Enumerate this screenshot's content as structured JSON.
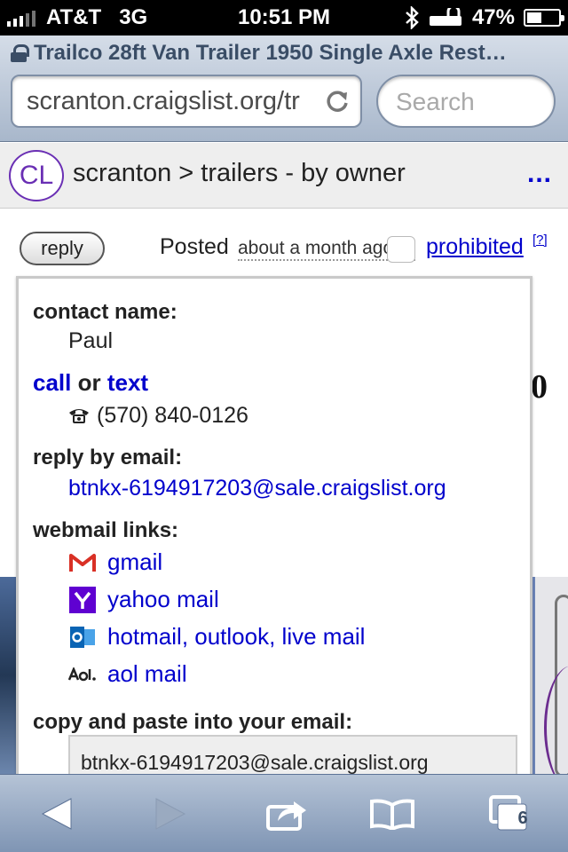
{
  "status_bar": {
    "carrier": "AT&T",
    "network": "3G",
    "time": "10:51 PM",
    "battery_percent": "47%",
    "battery_level": 0.47
  },
  "browser": {
    "page_title": "Trailco 28ft Van Trailer 1950 Single Axle Rest…",
    "url": "scranton.craigslist.org/tr",
    "search_placeholder": "Search",
    "tab_count": "6"
  },
  "site_header": {
    "logo": "CL",
    "breadcrumb": "scranton > trailers - by owner",
    "more": "..."
  },
  "posting_bar": {
    "reply_label": "reply",
    "posted_label": "Posted",
    "posted_time": "about a month ago",
    "prohibited_label": "prohibited",
    "help_label": "[?]"
  },
  "background": {
    "price_fragment": "0"
  },
  "reply_popup": {
    "contact_name_label": "contact name:",
    "contact_name": "Paul",
    "call_label": "call",
    "or_label": "or",
    "text_label": "text",
    "phone": "(570) 840-0126",
    "reply_email_label": "reply by email:",
    "reply_email": "btnkx-6194917203@sale.craigslist.org",
    "webmail_label": "webmail links:",
    "webmail_links": [
      {
        "label": "gmail",
        "icon": "gmail-icon"
      },
      {
        "label": "yahoo mail",
        "icon": "yahoo-icon"
      },
      {
        "label": "hotmail, outlook, live mail",
        "icon": "outlook-icon"
      },
      {
        "label": "aol mail",
        "icon": "aol-icon"
      }
    ],
    "copy_label": "copy and paste into your email:",
    "copy_value": "btnkx-6194917203@sale.craigslist.org"
  },
  "colors": {
    "link": "#0000cc",
    "craigslist_purple": "#6a2fb4"
  }
}
